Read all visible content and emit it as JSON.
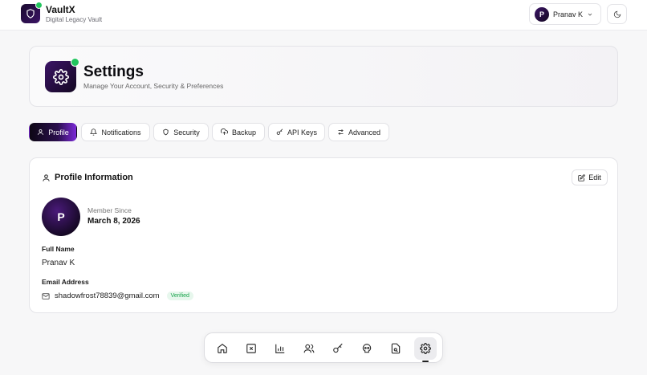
{
  "app": {
    "name": "VaultX",
    "tagline": "Digital Legacy Vault"
  },
  "user": {
    "initial": "P",
    "name": "Pranav K"
  },
  "header": {
    "title": "Settings",
    "subtitle": "Manage Your Account, Security & Preferences"
  },
  "tabs": [
    {
      "label": "Profile",
      "icon": "user-icon",
      "active": true
    },
    {
      "label": "Notifications",
      "icon": "bell-icon",
      "active": false
    },
    {
      "label": "Security",
      "icon": "shield-icon",
      "active": false
    },
    {
      "label": "Backup",
      "icon": "cloud-upload-icon",
      "active": false
    },
    {
      "label": "API Keys",
      "icon": "key-icon",
      "active": false
    },
    {
      "label": "Advanced",
      "icon": "sliders-icon",
      "active": false
    }
  ],
  "profile": {
    "section_title": "Profile Information",
    "edit_label": "Edit",
    "avatar_initial": "P",
    "member_since_label": "Member Since",
    "member_since_value": "March 8, 2026",
    "full_name_label": "Full Name",
    "full_name_value": "Pranav K",
    "email_label": "Email Address",
    "email_value": "shadowfrost78839@gmail.com",
    "verified_label": "Verified"
  },
  "dock": [
    {
      "icon": "home-icon",
      "active": false
    },
    {
      "icon": "x-square-icon",
      "active": false
    },
    {
      "icon": "bar-chart-icon",
      "active": false
    },
    {
      "icon": "users-icon",
      "active": false
    },
    {
      "icon": "key-icon",
      "active": false
    },
    {
      "icon": "skull-icon",
      "active": false
    },
    {
      "icon": "file-search-icon",
      "active": false
    },
    {
      "icon": "gear-icon",
      "active": true
    }
  ],
  "colors": {
    "accent_dark": "#140822",
    "accent_purple": "#7c2ad8",
    "success": "#22c55e"
  }
}
